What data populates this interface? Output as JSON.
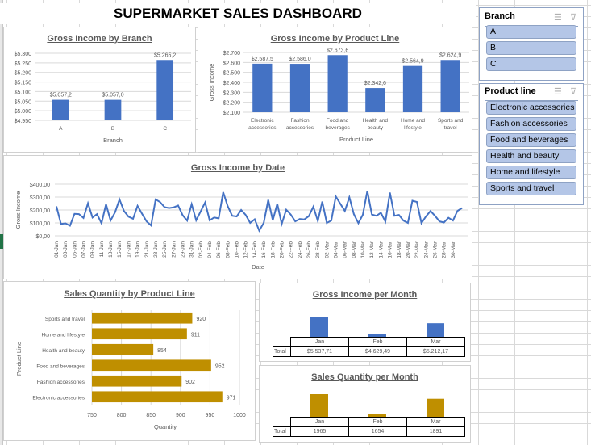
{
  "dashboard_title": "SUPERMARKET SALES DASHBOARD",
  "slicers": {
    "branch": {
      "title": "Branch",
      "items": [
        "A",
        "B",
        "C"
      ]
    },
    "product_line": {
      "title": "Product line",
      "items": [
        "Electronic accessories",
        "Fashion accessories",
        "Food and beverages",
        "Health and beauty",
        "Home and lifestyle",
        "Sports and travel"
      ]
    }
  },
  "colors": {
    "blue": "#4472c4",
    "gold": "#bf8f00"
  },
  "chart_data": [
    {
      "id": "branch",
      "type": "bar",
      "title": "Gross Income by Branch",
      "xlabel": "Branch",
      "ylabel": "",
      "categories": [
        "A",
        "B",
        "C"
      ],
      "values": [
        5057.2,
        5057.0,
        5265.2
      ],
      "data_labels": [
        "$5.057,2",
        "$5.057,0",
        "$5.265,2"
      ],
      "ylim": [
        4950,
        5300
      ],
      "yticks": [
        "$4.950",
        "$5.000",
        "$5.050",
        "$5.100",
        "$5.150",
        "$5.200",
        "$5.250",
        "$5.300"
      ],
      "grid": true
    },
    {
      "id": "product",
      "type": "bar",
      "title": "Gross Income by Product Line",
      "xlabel": "Product Line",
      "ylabel": "Gross Income",
      "categories": [
        [
          "Electronic",
          "accessories"
        ],
        [
          "Fashion",
          "accessories"
        ],
        [
          "Food and",
          "beverages"
        ],
        [
          "Health and",
          "beauty"
        ],
        [
          "Home and",
          "lifestyle"
        ],
        [
          "Sports and",
          "travel"
        ]
      ],
      "values": [
        2587.5,
        2586.0,
        2673.6,
        2342.6,
        2564.9,
        2624.9
      ],
      "data_labels": [
        "$2.587,5",
        "$2.586,0",
        "$2.673,6",
        "$2.342,6",
        "$2.564,9",
        "$2.624,9"
      ],
      "ylim": [
        2100,
        2700
      ],
      "yticks": [
        "$2.100",
        "$2.200",
        "$2.300",
        "$2.400",
        "$2.500",
        "$2.600",
        "$2.700"
      ],
      "grid": true
    },
    {
      "id": "date",
      "type": "line",
      "title": "Gross Income by Date",
      "xlabel": "Date",
      "ylabel": "Gross Income",
      "ylim": [
        0,
        400
      ],
      "yticks": [
        "$0,00",
        "$100,00",
        "$200,00",
        "$300,00",
        "$400,00"
      ],
      "xtick_labels": [
        "01-Jan",
        "03-Jan",
        "05-Jan",
        "07-Jan",
        "09-Jan",
        "11-Jan",
        "13-Jan",
        "15-Jan",
        "17-Jan",
        "19-Jan",
        "21-Jan",
        "23-Jan",
        "25-Jan",
        "27-Jan",
        "29-Jan",
        "31-Jan",
        "02-Feb",
        "04-Feb",
        "06-Feb",
        "08-Feb",
        "10-Feb",
        "12-Feb",
        "14-Feb",
        "16-Feb",
        "18-Feb",
        "20-Feb",
        "22-Feb",
        "24-Feb",
        "26-Feb",
        "28-Feb",
        "02-Mar",
        "04-Mar",
        "06-Mar",
        "08-Mar",
        "10-Mar",
        "12-Mar",
        "14-Mar",
        "16-Mar",
        "18-Mar",
        "20-Mar",
        "22-Mar",
        "24-Mar",
        "26-Mar",
        "28-Mar",
        "30-Mar"
      ],
      "values": [
        228,
        92,
        97,
        78,
        170,
        168,
        138,
        252,
        142,
        168,
        97,
        245,
        118,
        182,
        282,
        192,
        148,
        132,
        232,
        170,
        112,
        80,
        282,
        262,
        222,
        215,
        220,
        235,
        160,
        118,
        245,
        120,
        188,
        258,
        120,
        142,
        135,
        338,
        230,
        155,
        150,
        200,
        162,
        100,
        128,
        40,
        100,
        278,
        120,
        248,
        92,
        202,
        165,
        112,
        130,
        127,
        152,
        225,
        115,
        265,
        100,
        118,
        305,
        248,
        192,
        298,
        168,
        98,
        163,
        348,
        165,
        155,
        178,
        110,
        335,
        155,
        162,
        118,
        100,
        272,
        262,
        98,
        150,
        192,
        155,
        112,
        103,
        140,
        118,
        193,
        215
      ],
      "grid": true
    },
    {
      "id": "qty",
      "type": "bar",
      "orientation": "horizontal",
      "title": "Sales Quantity by Product Line",
      "xlabel": "Quantity",
      "ylabel": "Product Line",
      "categories": [
        "Sports and travel",
        "Home and lifestyle",
        "Health and beauty",
        "Food and beverages",
        "Fashion accessories",
        "Electronic accessories"
      ],
      "values": [
        920,
        911,
        854,
        952,
        902,
        971
      ],
      "xlim": [
        750,
        1000
      ],
      "xticks": [
        "750",
        "800",
        "850",
        "900",
        "950",
        "1000"
      ],
      "grid": true
    },
    {
      "id": "gi_month",
      "type": "bar",
      "title": "Gross Income per Month",
      "categories": [
        "Jan",
        "Feb",
        "Mar"
      ],
      "values": [
        5537.71,
        4629.49,
        5212.17
      ],
      "table_row_label": "Total",
      "table_values": [
        "$5.537,71",
        "$4.629,49",
        "$5.212,17"
      ]
    },
    {
      "id": "qty_month",
      "type": "bar",
      "title": "Sales Quantity per Month",
      "categories": [
        "Jan",
        "Feb",
        "Mar"
      ],
      "values": [
        1965,
        1654,
        1891
      ],
      "table_row_label": "Total",
      "table_values": [
        "1965",
        "1654",
        "1891"
      ]
    }
  ]
}
